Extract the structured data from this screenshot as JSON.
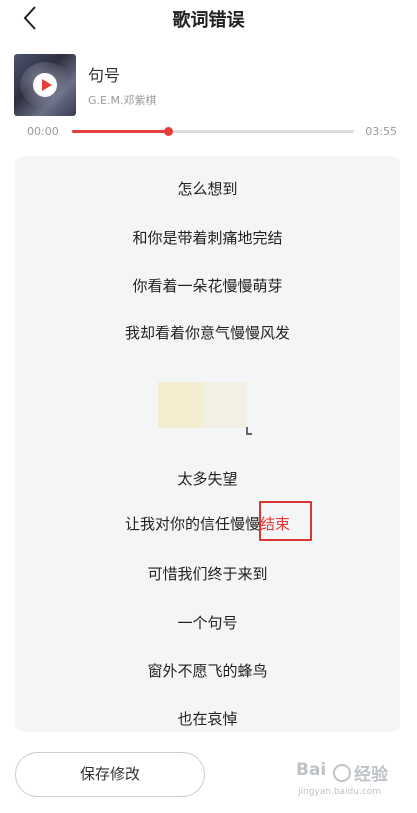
{
  "header": {
    "back_icon": "chevron-left-icon",
    "title": "歌词错误"
  },
  "song": {
    "title": "句号",
    "artist": "G.E.M.邓紫棋",
    "play_icon": "play-icon"
  },
  "player": {
    "current_time": "00:00",
    "total_time": "03:55",
    "progress": 0.34,
    "accent_color": "#e83c3c"
  },
  "lyrics": {
    "lines": [
      {
        "text": "怎么想到"
      },
      {
        "text": "和你是带着刺痛地完结"
      },
      {
        "text": "你看着一朵花慢慢萌芽"
      },
      {
        "text": "我却看着你意气慢慢风发"
      },
      {
        "text": "太多失望"
      },
      {
        "text": "让我对你的信任慢慢",
        "error_text": "结束"
      },
      {
        "text": "可惜我们终于来到"
      },
      {
        "text": "一个句号"
      },
      {
        "text": "窗外不愿飞的蜂鸟"
      },
      {
        "text": "也在哀悼"
      }
    ],
    "error_color": "#e53935"
  },
  "footer": {
    "save_label": "保存修改"
  },
  "watermark": {
    "logo": "Bai",
    "word": "经验",
    "url": "jingyan.baidu.com"
  }
}
